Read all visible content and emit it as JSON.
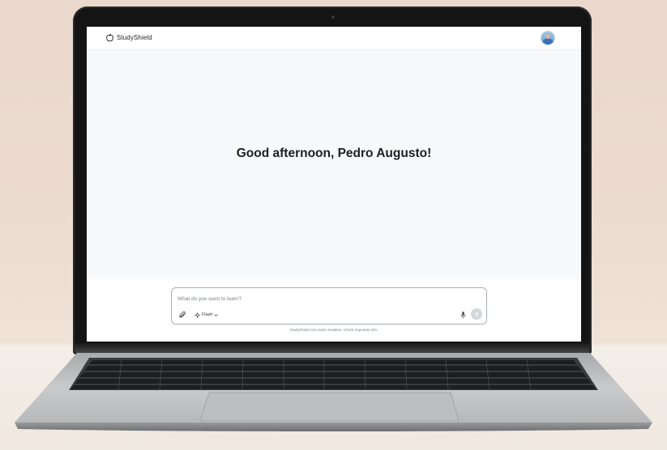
{
  "app": {
    "name": "StudyShield"
  },
  "header": {
    "logo_text": "StudyShield",
    "logo_icon": "apple-outline-icon",
    "avatar_icon": "user-avatar"
  },
  "main": {
    "greeting": "Good afternoon, Pedro Augusto!"
  },
  "composer": {
    "placeholder": "What do you want to learn?",
    "value": "",
    "attach_icon": "paperclip-icon",
    "model_label": "Flash",
    "model_icon": "sparkle-icon",
    "model_dropdown_icon": "chevron-down-icon",
    "mic_icon": "microphone-icon",
    "send_icon": "arrow-up-icon"
  },
  "footer": {
    "disclaimer": "StudyShield can make mistakes. Check important info."
  },
  "colors": {
    "screen_bg": "#f8f9fb",
    "topbar_bg": "#ffffff",
    "text_primary": "#1b1e23",
    "border": "#a9adb4",
    "send_button": "#d4d7dc"
  }
}
